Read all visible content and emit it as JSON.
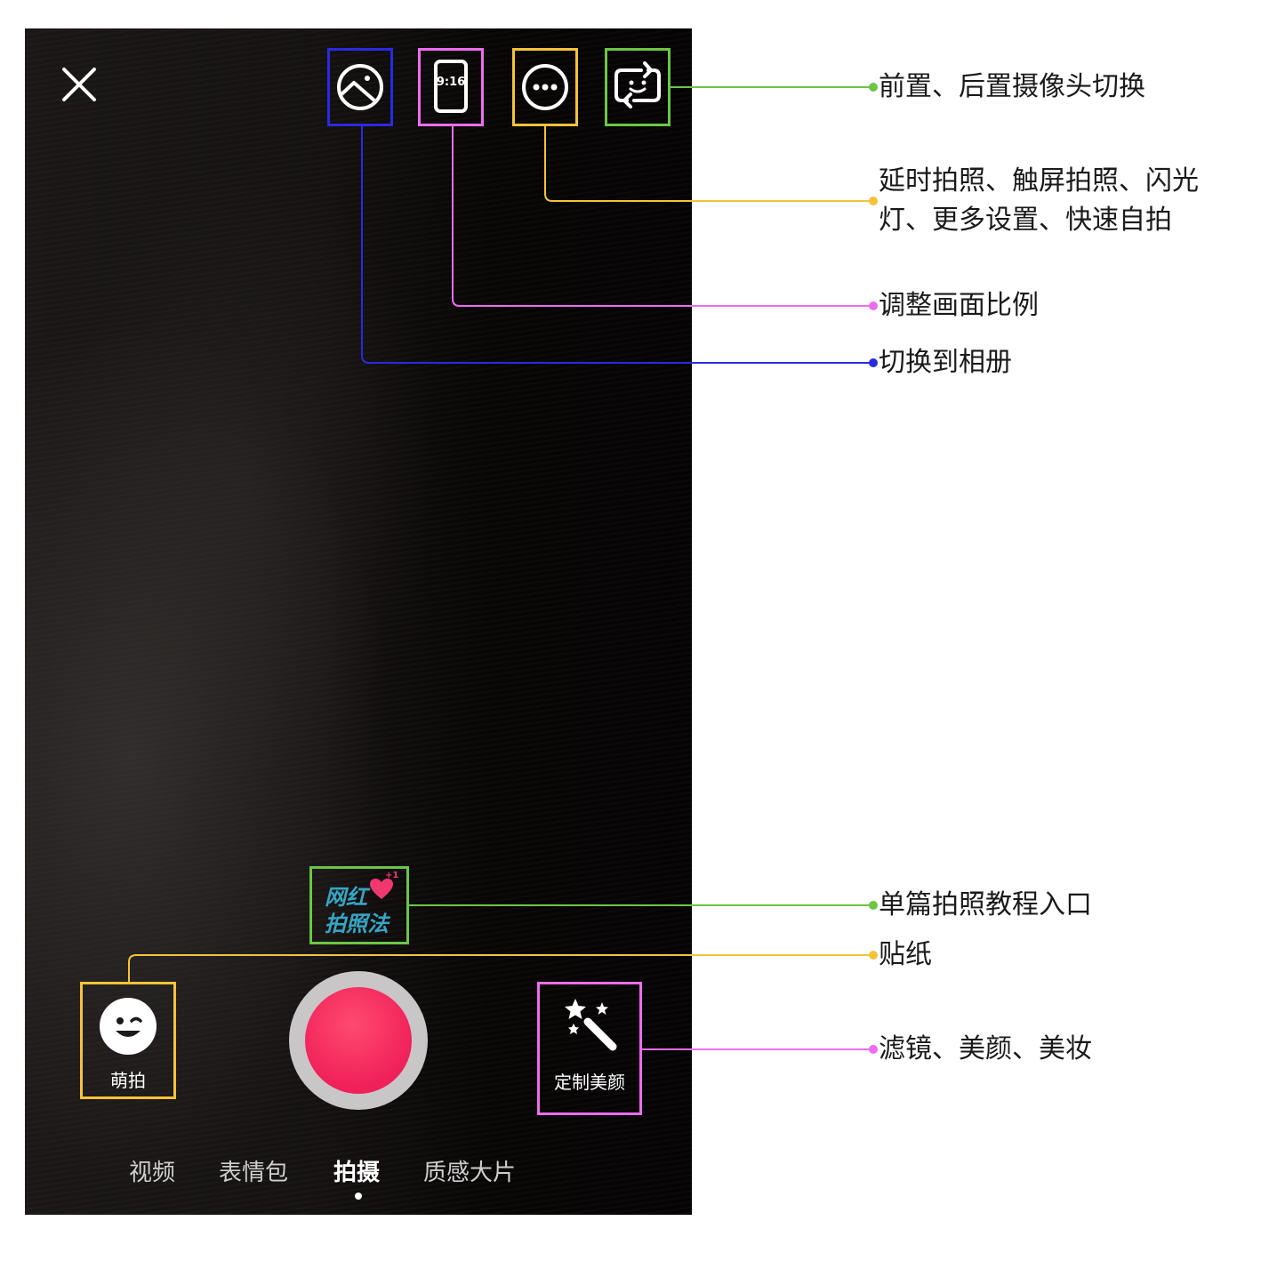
{
  "camera": {
    "mode_tabs": [
      {
        "label": "视频"
      },
      {
        "label": "表情包"
      },
      {
        "label": "拍摄",
        "active": true
      },
      {
        "label": "质感大片"
      }
    ],
    "aspect_ratio_label": "9:16",
    "left_button_label": "萌拍",
    "right_button_label": "定制美颜",
    "tutorial_sticker": {
      "line1": "网红",
      "line2": "拍照法",
      "badge": "+1"
    }
  },
  "annotations": {
    "camera_switch": "前置、后置摄像头切换",
    "more_settings_line1": "延时拍照、触屏拍照、闪光",
    "more_settings_line2": "灯、更多设置、快速自拍",
    "aspect_ratio": "调整画面比例",
    "album": "切换到相册",
    "tutorial": "单篇拍照教程入口",
    "sticker": "贴纸",
    "beauty": "滤镜、美颜、美妆"
  },
  "colors": {
    "green": "#6cc644",
    "yellow": "#f5c23a",
    "magenta": "#ef6cf0",
    "blue": "#2a2ae0",
    "shutter": "#f0205a"
  },
  "icons": {
    "close": "close-icon",
    "album": "image-icon",
    "ratio": "aspect-ratio-icon",
    "more": "more-dots-icon",
    "flip": "camera-flip-icon",
    "face": "smiley-face-icon",
    "magic": "magic-wand-icon"
  }
}
